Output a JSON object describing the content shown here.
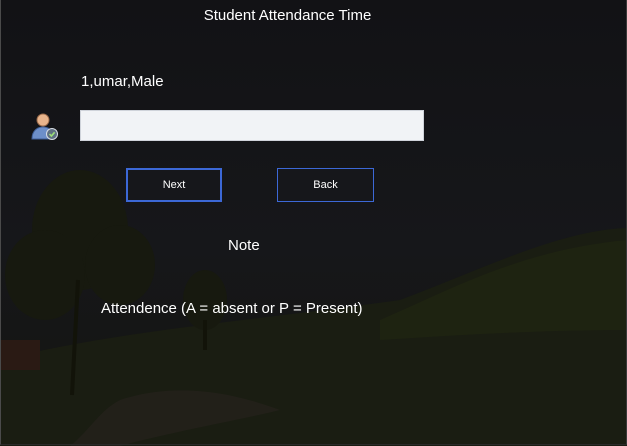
{
  "window": {
    "title": "Student Attendance Time"
  },
  "student": {
    "info": "1,umar,Male"
  },
  "input": {
    "value": "",
    "placeholder": ""
  },
  "buttons": {
    "next_label": "Next",
    "back_label": "Back"
  },
  "note": {
    "title": "Note",
    "text": "Attendence (A = absent or P = Present)"
  },
  "icons": {
    "student_icon": "user-check-icon"
  },
  "colors": {
    "background": "#141416",
    "button_border": "#3c68d6",
    "input_bg": "#f1f3f6",
    "text": "#ffffff"
  }
}
